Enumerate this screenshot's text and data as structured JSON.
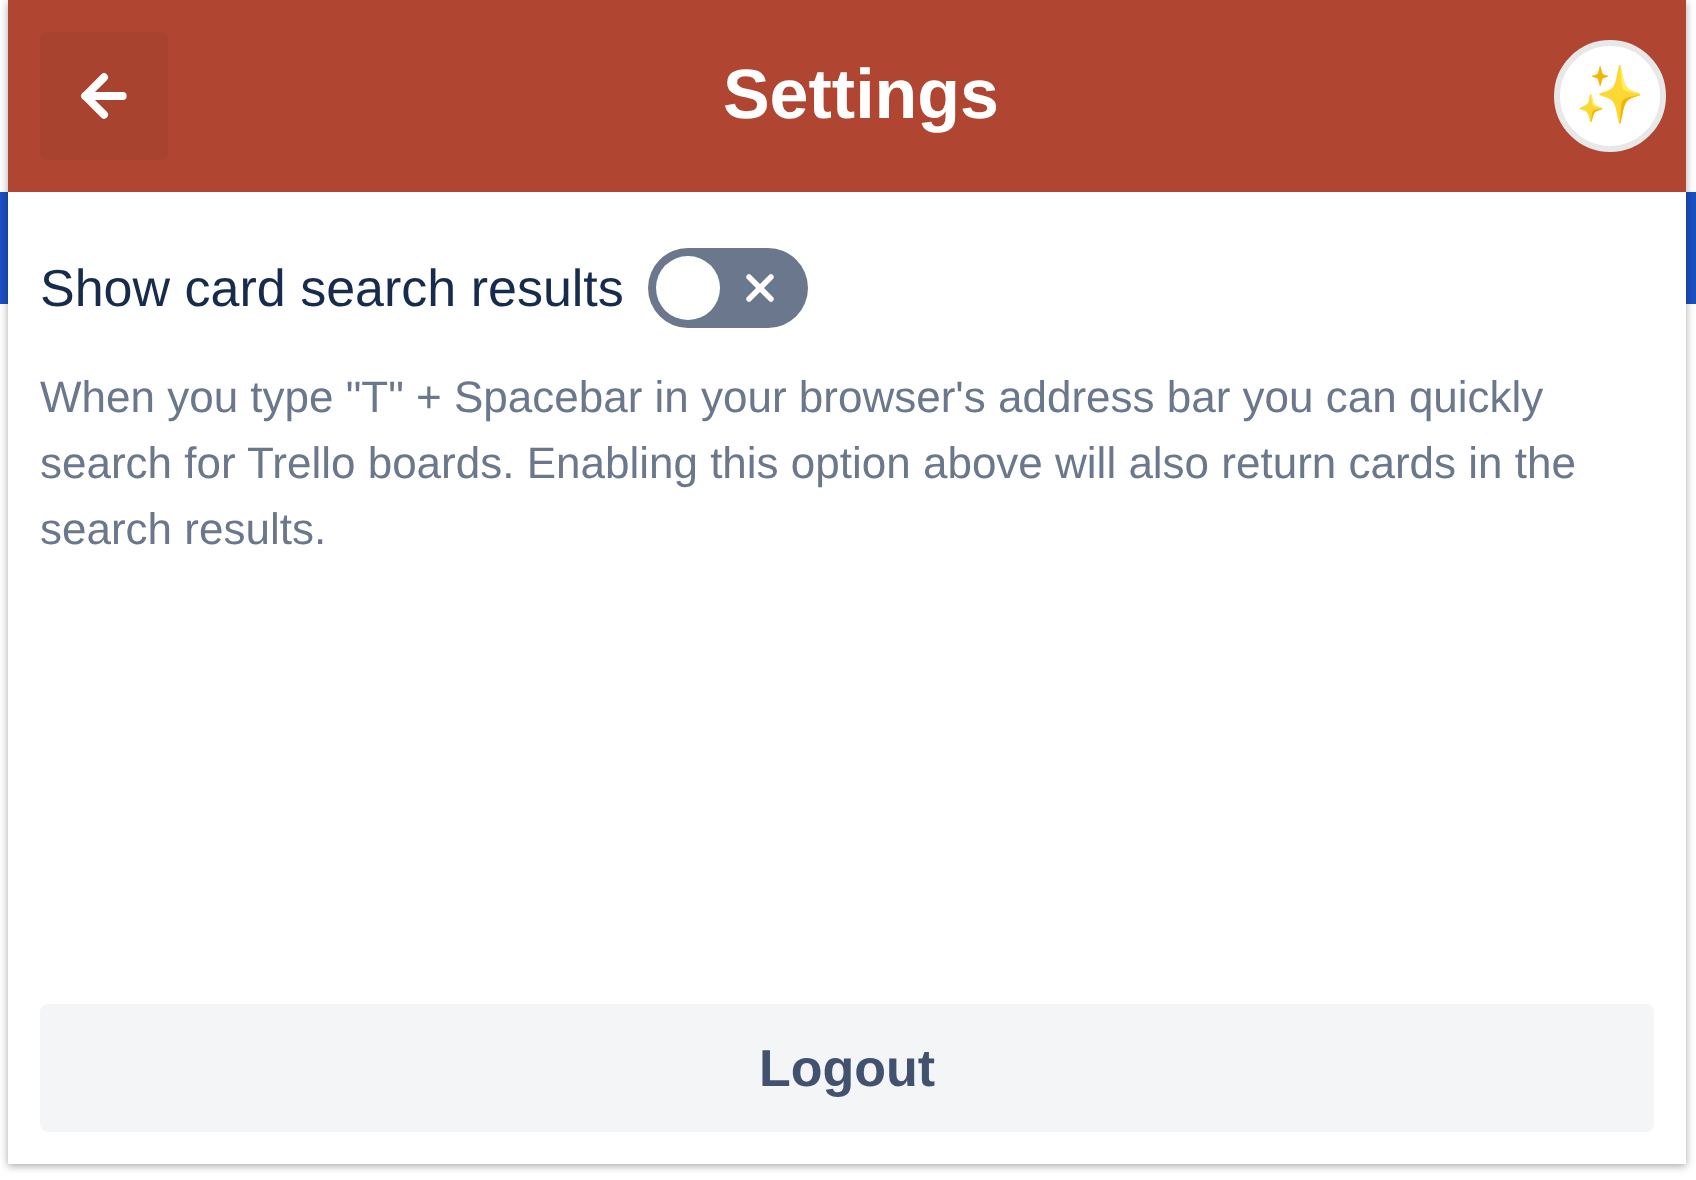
{
  "header": {
    "title": "Settings",
    "avatar": "✨"
  },
  "setting": {
    "label": "Show card search results",
    "on": false,
    "description": "When you type \"T\" + Spacebar in your browser's address bar you can quickly search for Trello boards. Enabling this option above will also return cards in the search results."
  },
  "logout": {
    "label": "Logout"
  }
}
